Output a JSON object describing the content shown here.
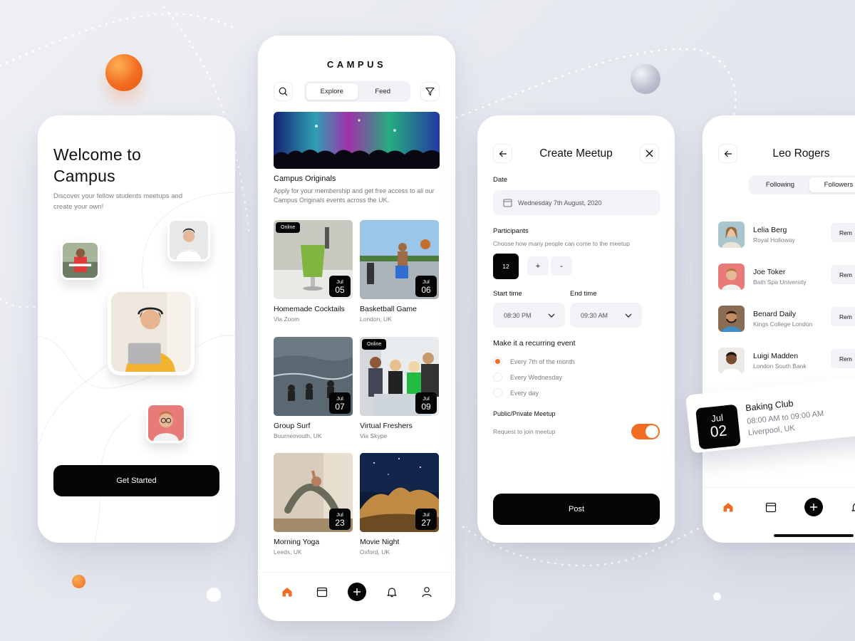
{
  "colors": {
    "accent": "#f26d21",
    "dark": "#050505",
    "muted": "#7d7f88",
    "field_bg": "#f2f3f6"
  },
  "welcome": {
    "title": "Welcome to Campus",
    "subtitle": "Discover your fellow students meetups and create your own!",
    "cta": "Get Started"
  },
  "explore": {
    "logo": "CAMPUS",
    "tabs": [
      {
        "label": "Explore",
        "active": true
      },
      {
        "label": "Feed",
        "active": false
      }
    ],
    "icons": [
      "search-icon",
      "filter-icon"
    ],
    "featured": {
      "title": "Campus Originals",
      "description": "Apply for your membership and get free access to all our Campus Originals events across the UK."
    },
    "events": [
      {
        "title": "Homemade Cocktails",
        "place": "Via Zoom",
        "month": "Jul",
        "day": "05",
        "badge": "Online"
      },
      {
        "title": "Basketball Game",
        "place": "London, UK",
        "month": "Jul",
        "day": "06",
        "badge": ""
      },
      {
        "title": "Group Surf",
        "place": "Bournemouth, UK",
        "month": "Jul",
        "day": "07",
        "badge": ""
      },
      {
        "title": "Virtual Freshers",
        "place": "Via Skype",
        "month": "Jul",
        "day": "09",
        "badge": "Online"
      },
      {
        "title": "Morning Yoga",
        "place": "Leeds, UK",
        "month": "Jul",
        "day": "23",
        "badge": ""
      },
      {
        "title": "Movie Night",
        "place": "Oxford, UK",
        "month": "Jul",
        "day": "27",
        "badge": ""
      }
    ],
    "tabbar": [
      "home-icon",
      "calendar-icon",
      "plus-icon",
      "bell-icon",
      "profile-icon"
    ]
  },
  "create": {
    "title": "Create Meetup",
    "date_label": "Date",
    "date_value": "Wednesday 7th August, 2020",
    "participants_label": "Participants",
    "participants_hint": "Choose how many people can come to the meetup",
    "participants_count": "12",
    "plus": "+",
    "minus": "-",
    "start_label": "Start time",
    "start_value": "08:30 PM",
    "end_label": "End time",
    "end_value": "09:30 AM",
    "recurring_label": "Make it a recurring event",
    "recurring_options": [
      {
        "label": "Every 7th of the month",
        "selected": true
      },
      {
        "label": "Every Wednesday",
        "selected": false
      },
      {
        "label": "Every day",
        "selected": false
      }
    ],
    "visibility_label": "Public/Private Meetup",
    "visibility_hint": "Request to join meetup",
    "visibility_on": true,
    "post": "Post"
  },
  "profile": {
    "name": "Leo Rogers",
    "tabs": [
      {
        "label": "Following",
        "active": false
      },
      {
        "label": "Followers",
        "active": true
      }
    ],
    "remove_label": "Rem",
    "people": [
      {
        "name": "Lelia Berg",
        "uni": "Royal Holloway"
      },
      {
        "name": "Joe Toker",
        "uni": "Bath Spa University"
      },
      {
        "name": "Benard Daily",
        "uni": "Kings College London"
      },
      {
        "name": "Luigi Madden",
        "uni": "London South Bank"
      }
    ],
    "floating_event": {
      "month": "Jul",
      "day": "02",
      "title": "Baking Club",
      "time": "08:00 AM to 09:00 AM",
      "place": "Liverpool, UK"
    }
  }
}
